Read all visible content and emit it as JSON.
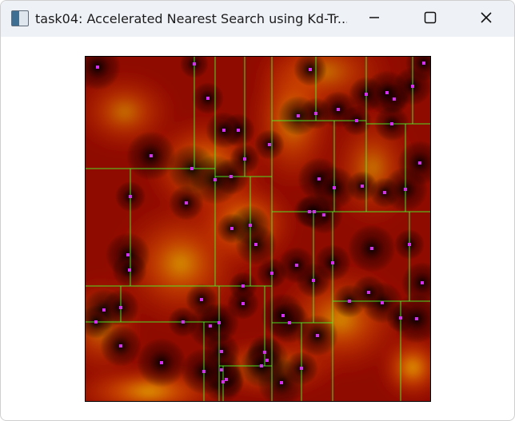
{
  "window": {
    "title": "task04: Accelerated Nearest Search using Kd-Tr...",
    "controls": {
      "minimize_icon": "minimize-icon",
      "maximize_icon": "maximize-icon",
      "close_icon": "close-icon"
    }
  },
  "colors": {
    "titlebar_bg": "#eef1f6",
    "field_dark": "#000000",
    "field_mid": "#c81a00",
    "field_hot": "#ff7a00",
    "field_bright": "#ffe600",
    "kd_lines": "#49ff2a",
    "points": "#d62ff4"
  },
  "visualization": {
    "points_count": 74
  }
}
